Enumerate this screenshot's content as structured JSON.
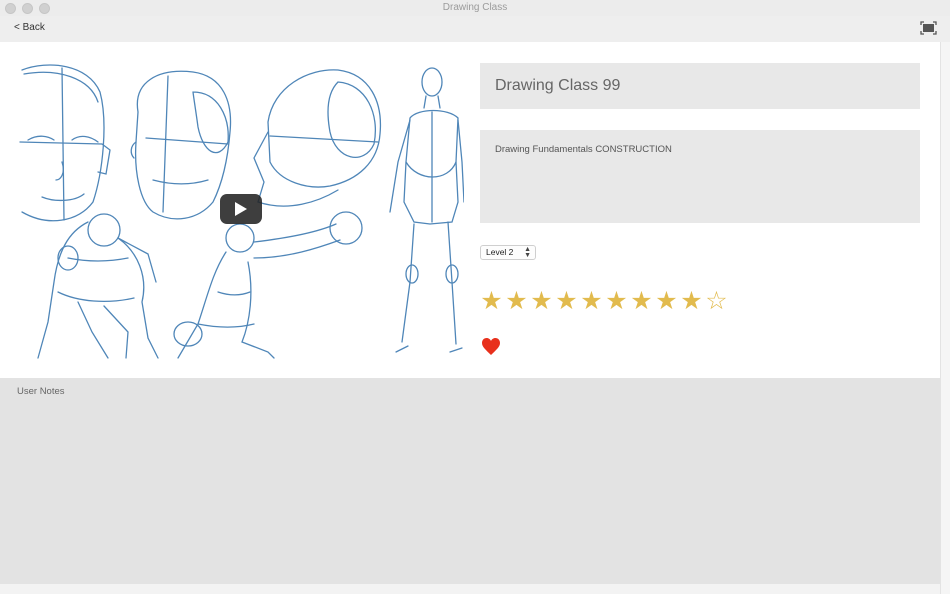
{
  "window": {
    "title": "Drawing Class"
  },
  "toolbar": {
    "back_label": "< Back",
    "fullscreen_icon": "fullscreen-icon"
  },
  "video": {
    "play_icon": "play-icon"
  },
  "lesson": {
    "title": "Drawing Class 99",
    "description": "Drawing Fundamentals CONSTRUCTION",
    "level": "Level 2",
    "rating": 9,
    "rating_max": 10,
    "favorite": true
  },
  "colors": {
    "star": "#e2bb4e",
    "heart": "#e8301c",
    "sketch": "#4f86b8"
  },
  "notes": {
    "label": "User Notes"
  }
}
